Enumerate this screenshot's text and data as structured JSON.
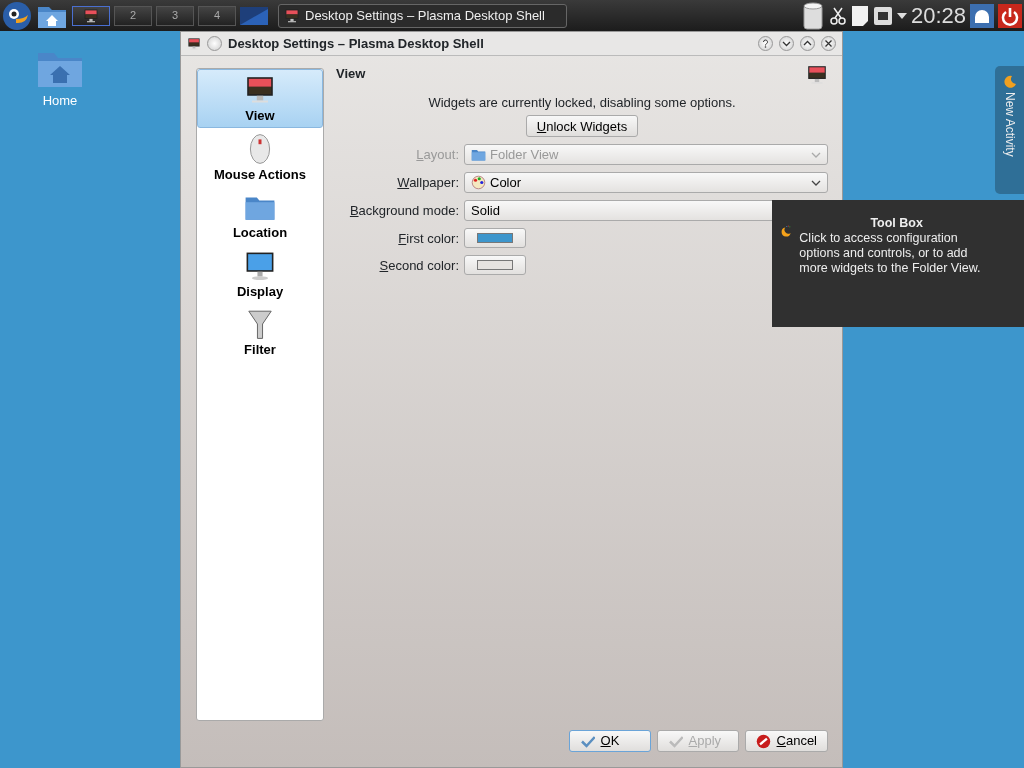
{
  "taskbar": {
    "pager": [
      {
        "selected": true
      },
      {
        "label": "2",
        "selected": false
      },
      {
        "label": "3",
        "selected": false
      },
      {
        "label": "4",
        "selected": false
      }
    ],
    "task": {
      "title": "Desktop Settings – Plasma Desktop Shell"
    },
    "clock": "20:28"
  },
  "desktop_icons": [
    {
      "label": "Home"
    }
  ],
  "dialog": {
    "title": "Desktop Settings – Plasma Desktop Shell",
    "pages": [
      {
        "label": "View",
        "selected": true
      },
      {
        "label": "Mouse Actions",
        "selected": false
      },
      {
        "label": "Location",
        "selected": false
      },
      {
        "label": "Display",
        "selected": false
      },
      {
        "label": "Filter",
        "selected": false
      }
    ],
    "heading": "View",
    "notice": "Widgets are currently locked, disabling some options.",
    "unlock_button": {
      "label": "Unlock Widgets",
      "mnemonic": true
    },
    "fields": [
      {
        "kind": "combo",
        "label": "Layout:",
        "value": "Folder View",
        "disabled": true,
        "mnemonic": true
      },
      {
        "kind": "combo",
        "label": "Wallpaper:",
        "value": "Color",
        "disabled": false,
        "mnemonic": true
      },
      {
        "kind": "combo",
        "label": "Background mode:",
        "value": "Solid",
        "disabled": false,
        "mnemonic": true
      },
      {
        "kind": "color",
        "label": "First color:",
        "color": "#3d96cc",
        "disabled": false,
        "mnemonic": true
      },
      {
        "kind": "color",
        "label": "Second color:",
        "color": "#e6e3e0",
        "disabled": false,
        "mnemonic": true
      }
    ],
    "buttons": [
      {
        "label": "OK",
        "disabled": false,
        "focused": true,
        "mnemonic": true
      },
      {
        "label": "Apply",
        "disabled": true,
        "focused": false,
        "mnemonic": true
      },
      {
        "label": "Cancel",
        "disabled": false,
        "focused": false,
        "mnemonic": true
      }
    ]
  },
  "activity_tab": {
    "label": "New Activity"
  },
  "tooltip": {
    "title": "Tool Box",
    "text": "Click to access configuration options and controls, or to add more widgets to the Folder View."
  }
}
